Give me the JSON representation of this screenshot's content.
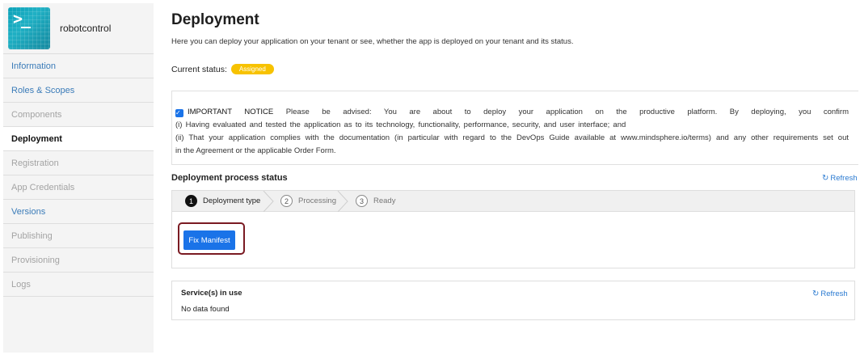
{
  "sidebar": {
    "app_name": "robotcontrol",
    "logo_glyph": ">_",
    "items": [
      {
        "label": "Information",
        "state": "link"
      },
      {
        "label": "Roles & Scopes",
        "state": "link"
      },
      {
        "label": "Components",
        "state": "muted"
      },
      {
        "label": "Deployment",
        "state": "active"
      },
      {
        "label": "Registration",
        "state": "muted"
      },
      {
        "label": "App Credentials",
        "state": "muted"
      },
      {
        "label": "Versions",
        "state": "link"
      },
      {
        "label": "Publishing",
        "state": "muted"
      },
      {
        "label": "Provisioning",
        "state": "muted"
      },
      {
        "label": "Logs",
        "state": "muted"
      }
    ]
  },
  "main": {
    "title": "Deployment",
    "subtitle": "Here you can deploy your application on your tenant or see, whether the app is deployed on your tenant and its status.",
    "status_label": "Current status:",
    "status_badge": "Assigned",
    "notice": {
      "checked": true,
      "heading": "IMPORTANT NOTICE",
      "line1": "Please be advised: You are about to deploy your application on the productive platform. By deploying, you confirm",
      "line2": "(i) Having evaluated and tested the application as to its technology, functionality, performance, security, and user interface; and",
      "line3": "(ii) That your application complies with the documentation (in particular with regard to the DevOps Guide available at www.mindsphere.io/terms) and any other requirements set out",
      "line4": "in the Agreement or the applicable Order Form."
    },
    "process": {
      "title": "Deployment process status",
      "refresh_label": "Refresh",
      "steps": [
        {
          "num": "1",
          "label": "Deployment type"
        },
        {
          "num": "2",
          "label": "Processing"
        },
        {
          "num": "3",
          "label": "Ready"
        }
      ],
      "fix_button": "Fix Manifest"
    },
    "services": {
      "title": "Service(s) in use",
      "refresh_label": "Refresh",
      "empty_text": "No data found"
    }
  }
}
